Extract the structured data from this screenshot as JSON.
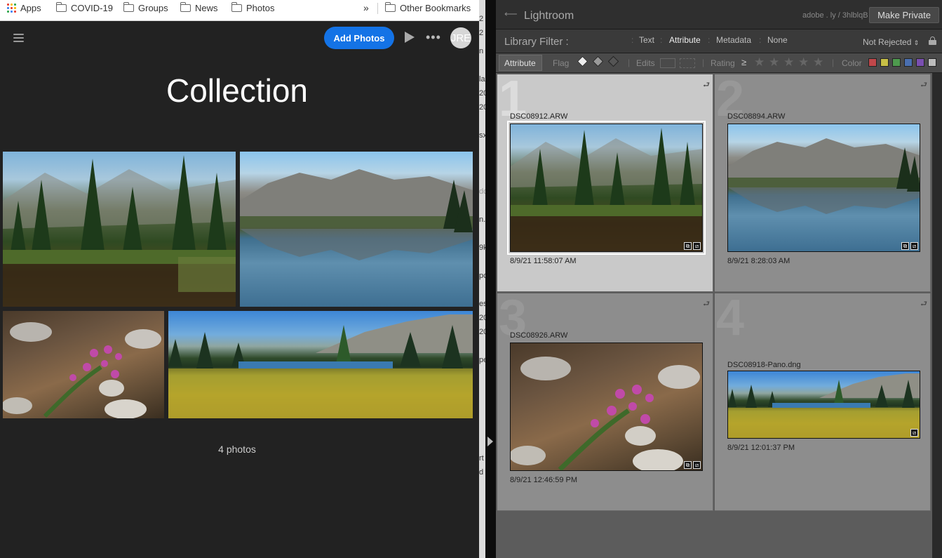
{
  "bookmarks": {
    "items": [
      "Apps",
      "COVID-19",
      "Groups",
      "News",
      "Photos"
    ],
    "overflow": "»",
    "other": "Other Bookmarks"
  },
  "web": {
    "menu_icon": "hamburger-icon",
    "add_photos": "Add Photos",
    "avatar_initials": "JRE",
    "title": "Collection",
    "photo_count": "4 photos"
  },
  "divider_strip_text": [
    "2",
    "2",
    "n",
    "la",
    "20",
    "20",
    "sx",
    "dc",
    "n.x",
    "9k",
    "pc",
    "es",
    "20",
    "20",
    "pe",
    "rt",
    "d"
  ],
  "lightroom": {
    "app_name": "Lightroom",
    "share_link": "adobe . ly / 3hlblqB",
    "make_private": "Make Private",
    "filter_label": "Library Filter :",
    "filter_tabs": [
      "Text",
      "Attribute",
      "Metadata",
      "None"
    ],
    "active_filter": "Attribute",
    "preset": "Not Rejected",
    "attr_label": "Attribute",
    "flag_label": "Flag",
    "edits_label": "Edits",
    "rating_label": "Rating",
    "rating_op": "≥",
    "color_label": "Color",
    "color_swatches": [
      "#c0474a",
      "#c8c046",
      "#4e9a4e",
      "#4a6fb0",
      "#7a4fb0",
      "#bdbdbd"
    ],
    "cells": [
      {
        "num": "1",
        "file": "DSC08912.ARW",
        "date": "8/9/21 11:58:07 AM",
        "selected": true
      },
      {
        "num": "2",
        "file": "DSC08894.ARW",
        "date": "8/9/21 8:28:03 AM",
        "selected": false
      },
      {
        "num": "3",
        "file": "DSC08926.ARW",
        "date": "8/9/21 12:46:59 PM",
        "selected": false
      },
      {
        "num": "4",
        "file": "DSC08918-Pano.dng",
        "date": "8/9/21 12:01:37 PM",
        "selected": false
      }
    ]
  }
}
